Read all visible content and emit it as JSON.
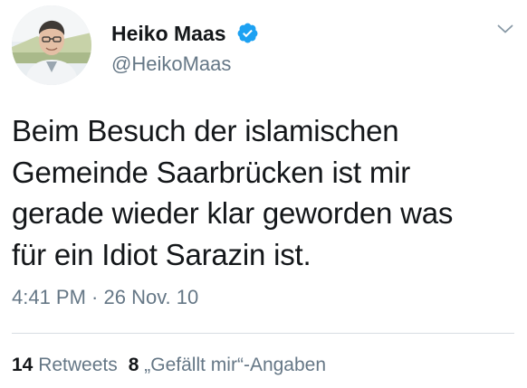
{
  "author": {
    "display_name": "Heiko Maas",
    "handle": "@HeikoMaas"
  },
  "tweet": {
    "lines": [
      "Beim Besuch der islamischen",
      "Gemeinde Saarbrücken ist mir",
      "gerade wieder klar geworden was",
      "für ein Idiot Sarazin ist."
    ],
    "timestamp": "4:41 PM · 26 Nov. 10"
  },
  "stats": {
    "retweets_count": "14",
    "retweets_label": "Retweets",
    "likes_count": "8",
    "likes_label": "„Gefällt mir“-Angaben"
  },
  "icons": {
    "verified": "verified-badge-icon",
    "menu": "chevron-down-icon"
  },
  "colors": {
    "text_primary": "#14171a",
    "text_secondary": "#657786",
    "verified_blue": "#1da1f2",
    "divider": "#d8dee3"
  }
}
